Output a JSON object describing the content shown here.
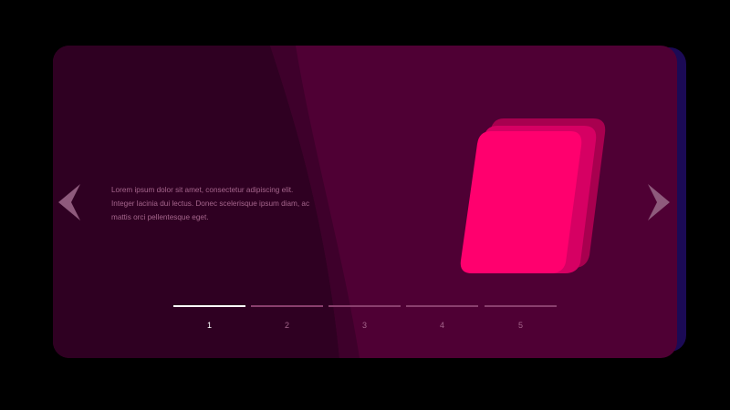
{
  "slide": {
    "caption": "Lorem ipsum dolor sit amet, consectetur adipiscing elit. Integer lacinia dui lectus. Donec scelerisque ipsum diam, ac mattis orci pellentesque eget."
  },
  "pager": {
    "active_index": 0,
    "items": [
      "1",
      "2",
      "3",
      "4",
      "5"
    ]
  },
  "icons": {
    "prev": "chevron-left-icon",
    "next": "chevron-right-icon"
  },
  "colors": {
    "card": "#4f0034",
    "card_dark": "#2f0022",
    "accent": "#ff006e",
    "accent_mid": "#d60063",
    "accent_back": "#a8004f",
    "back_plate": "#1b0a55"
  }
}
